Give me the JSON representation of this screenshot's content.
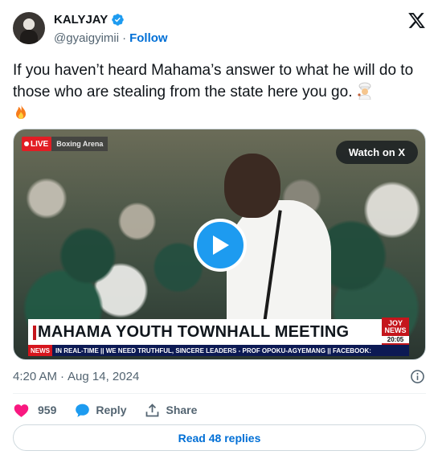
{
  "author": {
    "name": "KALYJAY",
    "handle": "@gyaigyimii",
    "separator": "·",
    "follow_label": "Follow"
  },
  "tweet": {
    "text": "If you haven’t heard Mahama’s answer to what he will do to those who are stealing from the state here you go.",
    "emojis": [
      "chef-emoji",
      "fire-emoji"
    ]
  },
  "video": {
    "live_tag": "LIVE",
    "venue": "Boxing Arena",
    "watch_label": "Watch on X",
    "banner": "MAHAMA YOUTH TOWNHALL MEETING",
    "ticker_tag": "NEWS",
    "ticker_text": "IN REAL-TIME || WE NEED TRUTHFUL, SINCERE LEADERS - PROF OPOKU-AGYEMANG || FACEBOOK:",
    "channel_top": "JOY",
    "channel_mid": "NEWS",
    "channel_time": "20:05"
  },
  "meta": {
    "time": "4:20 AM",
    "dot": "·",
    "date": "Aug 14, 2024"
  },
  "actions": {
    "likes": "959",
    "reply_label": "Reply",
    "share_label": "Share"
  },
  "replies_button": "Read 48 replies",
  "colors": {
    "accent": "#1d9bf0",
    "link": "#006fd6",
    "heart": "#f91880",
    "secondary_text": "#536471"
  }
}
